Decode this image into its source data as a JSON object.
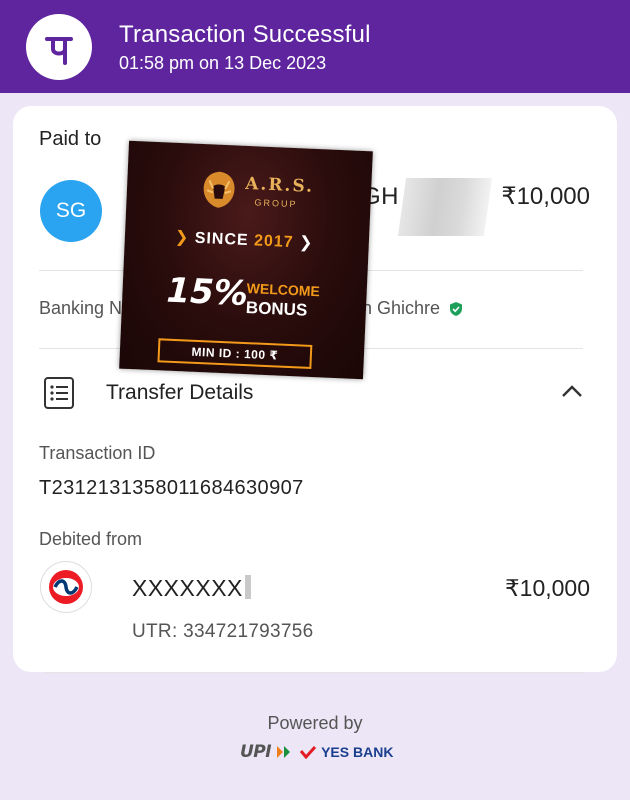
{
  "header": {
    "title": "Transaction Successful",
    "subtitle": "01:58 pm on 13 Dec 2023",
    "logo_glyph": "पे",
    "background": "#5f259f"
  },
  "paid_to": {
    "label": "Paid to",
    "avatar_initials": "SG",
    "avatar_color": "#2aa4f0",
    "name_visible": "S",
    "name_tail": "GH",
    "amount": "₹10,000"
  },
  "banking": {
    "label_visible": "Banking N",
    "name_visible": "n Ghichre",
    "verified_color": "#1ea05a"
  },
  "transfer_details": {
    "title": "Transfer Details",
    "transaction_id_label": "Transaction ID",
    "transaction_id": "T2312131358011684630907",
    "debited_label": "Debited from",
    "account": "XXXXXXX",
    "amount": "₹10,000",
    "utr": "UTR: 334721793756"
  },
  "footer": {
    "powered_by": "Powered by",
    "upi": "UPI",
    "bank": "YES BANK"
  },
  "ad_overlay": {
    "brand": "A.R.S.",
    "group": "GROUP",
    "since": "SINCE",
    "year": "2017",
    "percent": "15%",
    "welcome": "WELCOME",
    "bonus": "BONUS",
    "min_id": "MIN ID : 100 ₹"
  }
}
